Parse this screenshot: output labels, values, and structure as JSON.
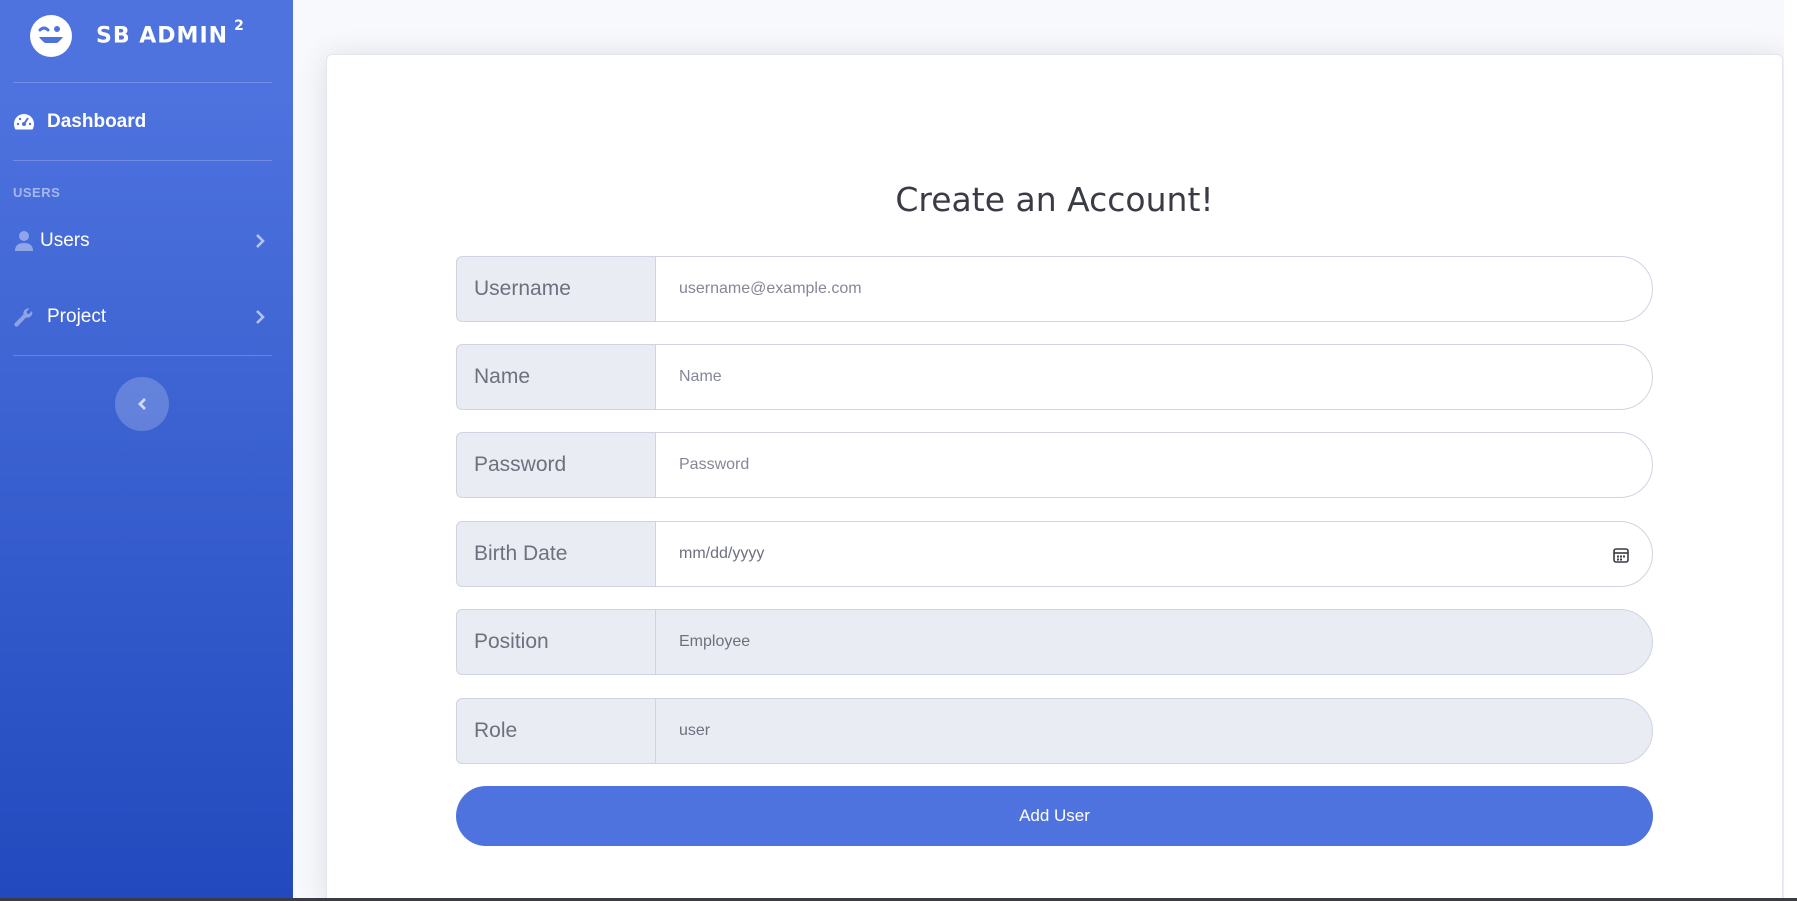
{
  "brand": {
    "name": "SB ADMIN",
    "superscript": "2",
    "icon": "laugh-wink-icon"
  },
  "sidebar": {
    "dashboard": {
      "label": "Dashboard",
      "icon": "tachometer-icon"
    },
    "heading": "USERS",
    "items": [
      {
        "label": "Users",
        "icon": "user-icon"
      },
      {
        "label": "Project",
        "icon": "wrench-icon"
      }
    ]
  },
  "form": {
    "title": "Create an Account!",
    "username": {
      "label": "Username",
      "placeholder": "username@example.com"
    },
    "name": {
      "label": "Name",
      "placeholder": "Name"
    },
    "password": {
      "label": "Password",
      "placeholder": "Password"
    },
    "birth_date": {
      "label": "Birth Date",
      "placeholder": "mm/dd/yyyy"
    },
    "position": {
      "label": "Position",
      "value": "Employee"
    },
    "role": {
      "label": "Role",
      "value": "user"
    },
    "submit_label": "Add User"
  },
  "colors": {
    "primary": "#4e73df",
    "primary_dark": "#224abe",
    "input_bg": "#eaecf4"
  }
}
